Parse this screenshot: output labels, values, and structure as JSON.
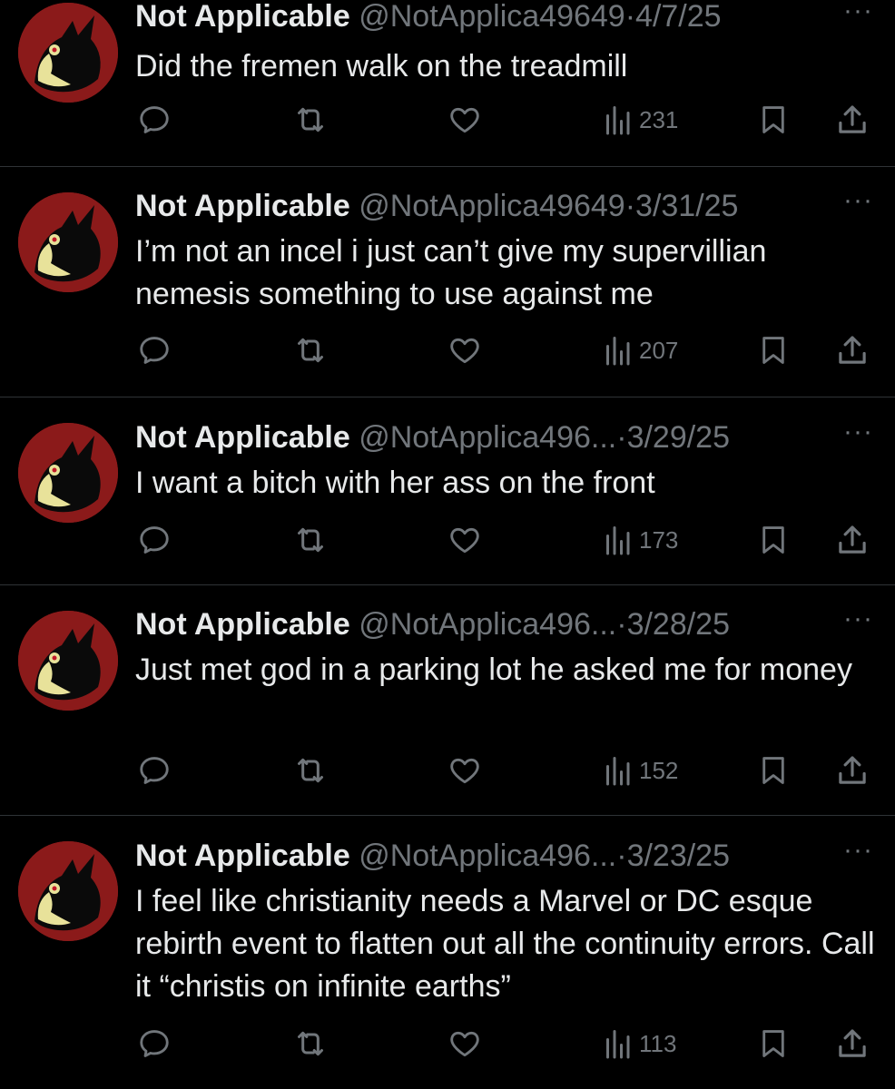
{
  "colors": {
    "background": "#000000",
    "text": "#e7e9ea",
    "muted": "#71767b",
    "divider": "#2f3336",
    "avatar_red": "#8b1a1a",
    "avatar_yellow": "#e8e29a"
  },
  "tweets": [
    {
      "name": "Not Applicable",
      "handle": "@NotApplica49649",
      "sep": "·",
      "date": "4/7/25",
      "more": "···",
      "text": "Did the fremen walk on the treadmill",
      "views": "231"
    },
    {
      "name": "Not Applicable",
      "handle": "@NotApplica49649",
      "sep": "·",
      "date": "3/31/25",
      "more": "···",
      "text": "I’m not an incel i just can’t give my supervillian nemesis something to use against me",
      "views": "207"
    },
    {
      "name": "Not Applicable",
      "handle": "@NotApplica496...",
      "sep": "·",
      "date": "3/29/25",
      "more": "···",
      "text": "I want a bitch with her ass on the front",
      "views": "173"
    },
    {
      "name": "Not Applicable",
      "handle": "@NotApplica496...",
      "sep": "·",
      "date": "3/28/25",
      "more": "···",
      "text": "Just met god in a parking lot he asked me for money",
      "views": "152"
    },
    {
      "name": "Not Applicable",
      "handle": "@NotApplica496...",
      "sep": "·",
      "date": "3/23/25",
      "more": "···",
      "text": "I feel like christianity needs a Marvel or DC esque rebirth event to flatten out all the continuity errors. Call it “christis on infinite earths”",
      "views": "113"
    }
  ],
  "icons": {
    "reply": "reply-icon",
    "retweet": "retweet-icon",
    "like": "heart-icon",
    "views": "views-chart-icon",
    "bookmark": "bookmark-icon",
    "share": "share-icon",
    "more": "more-icon"
  }
}
